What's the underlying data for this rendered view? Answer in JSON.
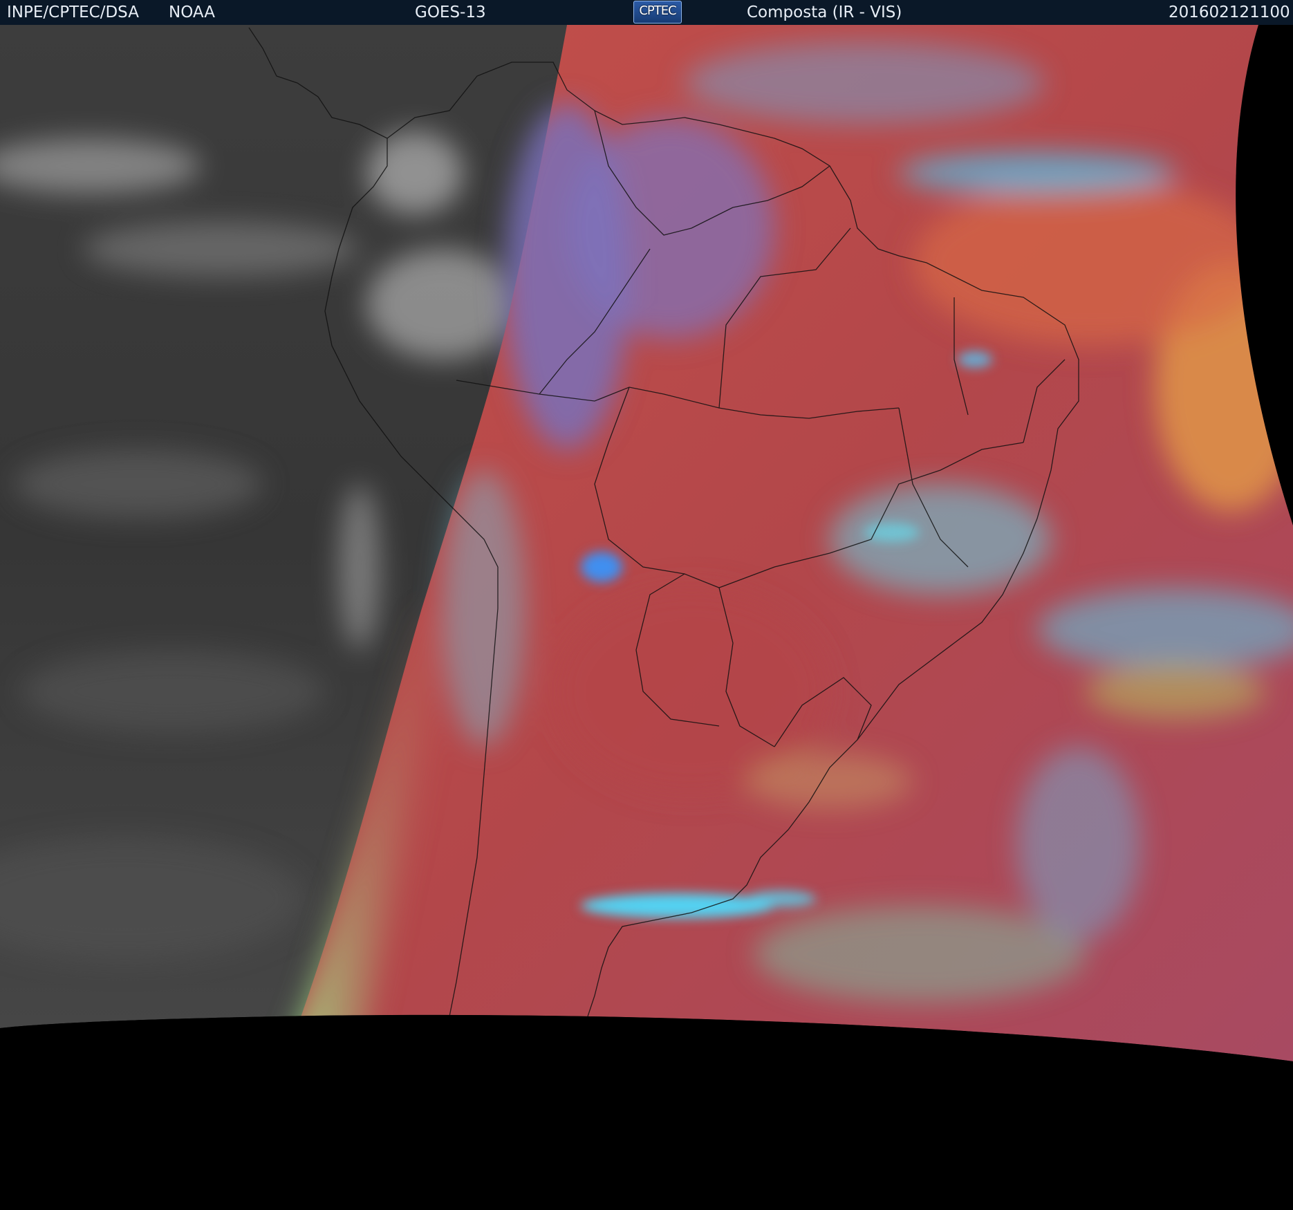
{
  "header": {
    "agency": "INPE/CPTEC/DSA",
    "partner": "NOAA",
    "satellite": "GOES-13",
    "logo_text": "CPTEC",
    "product": "Composta (IR - VIS)",
    "timestamp": "201602121100"
  },
  "map": {
    "colors": {
      "ir_gray_dark": "#3a3a3a",
      "ir_gray_light": "#cfcfcf",
      "composite_red": "#b5484a",
      "composite_orange": "#d96a45",
      "cloud_cyan": "#4ec8ea",
      "cloud_green": "#8ee890",
      "cloud_purple": "#7a70b8",
      "background": "#000000"
    }
  }
}
